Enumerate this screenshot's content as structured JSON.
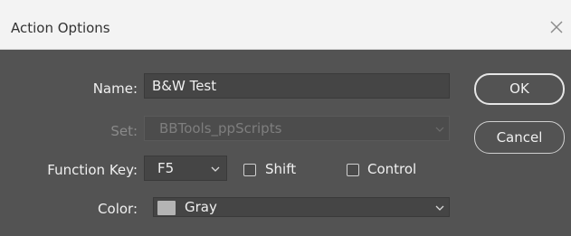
{
  "dialog": {
    "title": "Action Options",
    "close_icon": "close-icon"
  },
  "form": {
    "name_label": "Name:",
    "name_value": "B&W Test",
    "set_label": "Set:",
    "set_value": "BBTools_ppScripts",
    "function_key_label": "Function Key:",
    "function_key_value": "F5",
    "shift_label": "Shift",
    "shift_checked": false,
    "control_label": "Control",
    "control_checked": false,
    "color_label": "Color:",
    "color_value": "Gray",
    "color_swatch": "#b4b4b4"
  },
  "buttons": {
    "ok_label": "OK",
    "cancel_label": "Cancel"
  },
  "colors": {
    "panel_bg": "#535353",
    "titlebar_bg": "#f3f3f3",
    "field_bg": "#454545"
  }
}
